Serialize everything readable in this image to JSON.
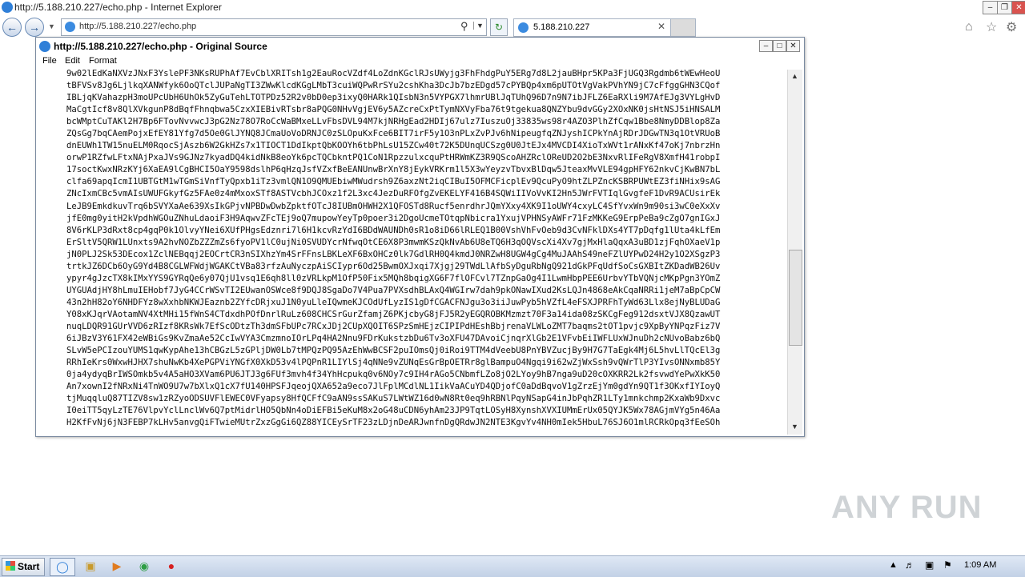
{
  "ie": {
    "title": "http://5.188.210.227/echo.php - Internet Explorer",
    "address": "http://5.188.210.227/echo.php",
    "tab_label": "5.188.210.227"
  },
  "source_window": {
    "title": "http://5.188.210.227/echo.php - Original Source",
    "menu": [
      "File",
      "Edit",
      "Format"
    ],
    "lines": [
      "9w02lEdKaNXVzJNxF3YslePF3NKsRUPhAf7EvCblXRITsh1g2EauRocVZdf4LoZdnKGclRJsUWyjg3FhFhdgPuY5ERg7d8L2jauBHpr5KPa3FjUGQ3Rgdmb6tWEwHeoU",
      "tBFVSv8Jg6LjlkqXANWfyk6OoQTclJUPaNgTI3ZWwKlcdKGgLMbT3cuiWQPwRrSYu2cshKha3DcJb7bzEDgd57cPYBQp4xm6pUTOtVgVakPVhYN9jC7cFfggGHN3CQof",
      "IBLjqKVahazpH3moUPcUbH6UhOk5ZyGuTehLTOTPDz52R2v0bD0ep3ixyQ0HARk1QIsbN3n5VYPGX7lhmrUBlJqTUhQ96D7n9N7ibJFLZ6EaRXli9M7AfEJg3VYLgHvD",
      "MaCgtIcf8v8QlXVkgunP8dBqfFhnqbwa5CzxXIEBivRTsbr8aPQG0NHvVgjEV6y5AZcreCxPtTymNXVyFba76t9tgekua8QNZYbu9dvGGy2XOxNK0jsHtNSJ5iHNSALM",
      "bcWMptCuTAKl2H7Bp6FTovNvvwcJ3pG2Nz78O7RoCcWaBMxeLLvFbsDVL94M7kjNRHgEad2HDIj67ulz7IuszuOj33835ws98r4AZO3PlhZfCqw1Bbe8NmyDDBlop8Za",
      "ZQsGg7bqCAemPojxEfEY81Yfg7d5Oe0GlJYNQ8JCmaUoVoDRNJC0zSLOpuKxFce6BIT7irF5y1O3nPLxZvPJv6hNipeugfqZNJyshICPkYnAjRDrJDGwTN3q1OtVRUoB",
      "dnEUWh1TW15nuELM0RqocSjAszb6W2GkHZs7x1TIOCT1DdIkptQbKOOYh6tbPhLsU15ZCw40t72K5DUnqUCSzg0U0JtEJx4MVCDI4XioTxWVt1rANxKf47oKj7nbrzHn",
      "orwP1RZfwLFtxNAjPxaJVs9GJNz7kyadDQ4kidNkB8eoYk6pcTQCbkntPQ1CoN1RpzzulxcquPtHRWmKZ3R9QScoAHZRclOReUD2O2bE3NxvRlIFeRgV8XmfH41robpI",
      "17soctKwxNRzKYj6XaEA9lCgBHCI5OaY9598dslhP6qHzqJsfVZxfBeEANUnwBrXnY8jEykVRKrm1l5X3wYeyzvTbvxBlDqw5JteaxMvVLE94gpHFY62nkvCjKwBN7bL",
      "clfa69apqIcmI1UBTGtM1wTGmSiVnfTyQpxb1iTz3vmlQN1O9QMUEbiwMWudrsh9Z6axzNt2iqCIBuI5OFMCFicplEv9QcuPyO9htZLPZncKSBRPUWtEZ3fiNHix9sAG",
      "ZNcIxmCBc5vmAIsUWUFGkyfGz5FAe0z4mMxoxSTf8ASTVcbhJCOxz1f2L3xc4JezDuRFOfgZvEKELYF416B4SQWiIIVoVvKI2Hn5JWrFVTIqlGvgfeF1DvR9ACUsirEk",
      "LeJB9EmkdkuvTrq6bSVYXaAe639XsIkGPjvNPBDwDwbZpktfOTcJ8IUBmOHWH2X1QFOSTd8Rucf5enrdhrJQmYXxy4XK9I1oUWY4cxyLC4SfYvxWn9m90si3wC0eXxXv",
      "jfE0mg0yitH2kVpdhWGOuZNhuLdaoiF3H9AqwvZFcTEj9oQ7mupowYeyTp0poer3i2DgoUcmeTOtqpNbicra1YxujVPHNSyAWFr71FzMKKeG9ErpPeBa9cZgO7gnIGxJ",
      "8V6rKLP3dRxt8cp4gqP0k1OlvyYNei6XUfPHgsEdznri7l6H1kcvRzYdI6BDdWAUNDh0sR1o8iD66lRLEQ1B00VshVhFvOeb9d3CvNFklDXs4YT7pDqfg1lUta4kLfEm",
      "ErSltV5QRW1LUnxts9A2hvNOZbZZZmZs6fyoPV1lC0ujNi0SVUDYcrNfwqOtCE6X8P3mwmKSzQkNvAb6U8eTQ6H3qOQVscXi4Xv7gjMxHlaQqxA3uBD1zjFqhOXaeV1p",
      "jN0PLJ2Sk53DEcox1ZclNEBqqj2EOCrtCR3nSIXhzYm4SrFFnsLBKLeXF6BxOHCz0lk7GdlRH0Q4kmdJ0NRZwH8UGW4gCg4MuJAAhS49neFZlUYPwD24H2y1O2XSgzP3",
      "trtkJZ6DCb6OyG9Yd4B8CGLWFWdjWGAKCtVBa83rfzAuNyczpAiSCIypr6Od25BwmOXJxqi7Xjgj29TWdLlAfbSyDguRbNgQ921dGkPFqUdfSoCsGXBItZKDadWB26Uv",
      "ypyr4gJzcTX8kIMxYYS9GYRqQe6y07QjU1vsq1E6qh8ll0zVRLkpM1OfP50Fix5MQh8bqigXG6F7flOFCvl7TZnpGaOg4I1LwmHbpPEE6UrbvYTbVQNjcMKpPgn3YOmZ",
      "UYGUAdjHY8hLmuIEHobf7JyG4CCrWSvTI2EUwanOSWce8f9DQJ8SgaDo7V4Pua7PVXsdhBLAxQ4WGIrw7dah9pkONawIXud2KsLQJn4868eAkCqaNRRi1jeM7aBpCpCW",
      "43n2hH82oY6NHDFYz8wXxhbNKWJEaznb2ZYfcDRjxuJ1N0yuLleIQwmeKJCOdUfLyzIS1gDfCGACFNJgu3o3iiJuwPyb5hVZfL4eFSXJPRFhTyWd63Llx8ejNyBLUDaG",
      "Y08xKJqrVAotamNV4XtMHi15fWnS4CTdxdhPOfDnrlRuLz608CHCSrGurZfamjZ6PKjcbyG8jFJ5R2yEGQROBKMzmzt70F3a14ida08zSKCgFeg912dsxtVJX8QzawUT",
      "nuqLDQR91GUrVVD6zRIzf8KRsWk7EfScODtzTh3dmSFbUPc7RCxJDj2CUpXQOIT6SPzSmHEjzCIPIPdHEshBbjrenaVLWLoZMT7baqms2tOT1pvjc9XpByYNPqzFiz7V",
      "6iJBzV3Y61FX42eWBiGs9KvZmaAe52CcIwVYA3CmzmnoIOrLPq4HA2Nnu9FDrKukstzbDu6Tv3oXFU47DAvoiCjnqrXlGb2E1VFvbEiIWFLUxWJnuDh2cNUvoBabz6bQ",
      "SLvW5ePCIzouYUMS1qwKypAhe13hCBGzL5zGPljDW0Lb7tMPQzPQ95AzEhWwBCSF2puIOmsQj0iRoi9TTM4dVeebU8PnYBVZucjBy9H7G7TaEgk4Mj6L5hvLlTQcEl3g",
      "RRhIeKrs0WxwHJHX7shuNwKb4XePGPViYNGfX0XkD53v4lPQPnR1LIYlSj4qNNe9vZUNqEsGrBpOETRr8glBampuO4Ngqi9i62wZjWxSsh9vQWrTlP3YIvsONNxmb85Y",
      "0ja4ydyqBrIWSOmkb5v4A5aHO3XVam6PU6JTJ3g6FUf3mvh4f34YhHcpukq0v6NOy7c9IH4rAGo5CNbmfLZo8jO2LYoy9hB7nga9uD20cOXKRR2Lk2fsvwdYePwXkK50",
      "An7xownI2fNRxNi4TnWO9U7w7bXlxQ1cX7fU140HPSFJqeojQXA652a9eco7JlFplMCdlNL1IikVaACuYD4QDjofC0aDdBqvoV1gZrzEjYm0gdYn9QT1f3OKxfIYIoyQ",
      "tjMuqqluQ87TIZV8sw1zRZyoODSUVFlEWEC0VFyapsy8HfQCFfC9aAN9ssSAKuS7LWtWZ16d0wN8Rt0eq9hRBNlPqyNSapG4inJbPqhZR1LTy1mnkchmp2KxaWb9Dxvc",
      "I0eiTT5qyLzTE76VlpvYclLnclWv6Q7ptMidrlHO5QbNn4oDiEFBi5eKuM8x2oG48uCDN6yhAm23JP9TqtLOSyH8XynshXVXIUMmErUx05QYJK5Wx78AGjmVYg5n46Aa",
      "H2KfFvNj6jN3FEBP7kLHv5anvgQiFTwieMUtrZxzGgGi6QZ88YICEySrTF23zLDjnDeARJwnfnDgQRdwJN2NTE3KgvYv4NH0mIek5HbuL76SJ6O1mlRCRkOpq3fEeSOh"
    ]
  },
  "taskbar": {
    "start_label": "Start",
    "clock": "1:09 AM"
  },
  "watermark": "ANY RUN"
}
